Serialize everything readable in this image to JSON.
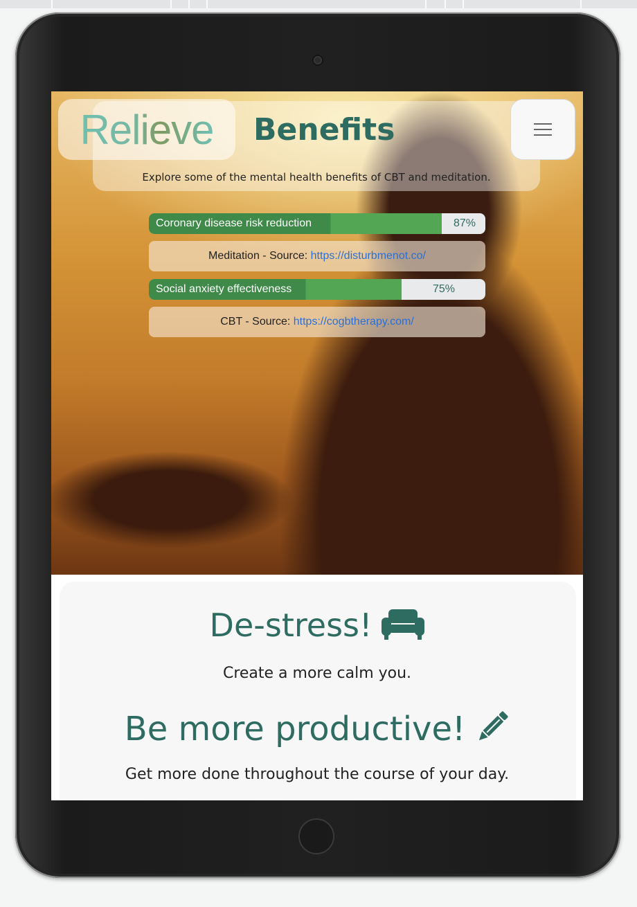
{
  "brand": {
    "logo_text": "Relieve"
  },
  "page": {
    "title": "Benefits",
    "subtitle": "Explore some of the mental health benefits of CBT and meditation."
  },
  "menu": {
    "icon": "hamburger-icon"
  },
  "stats": [
    {
      "label": "Coronary disease risk reduction",
      "percent": 87,
      "percent_text": "87%",
      "source_prefix": "Meditation - Source: ",
      "source_link": "https://disturbmenot.co/"
    },
    {
      "label": "Social anxiety effectiveness",
      "percent": 75,
      "percent_text": "75%",
      "source_prefix": "CBT - Source: ",
      "source_link": "https://cogbtherapy.com/"
    }
  ],
  "features": [
    {
      "heading": "De-stress!",
      "icon": "couch-icon",
      "text": "Create a more calm you."
    },
    {
      "heading": "Be more productive!",
      "icon": "pencil-icon",
      "text": "Get more done throughout the course of your day."
    }
  ],
  "colors": {
    "accent": "#2e6b60",
    "bar_dark": "#3f8a49",
    "bar_light": "#52a654",
    "link": "#2a6fd6"
  }
}
